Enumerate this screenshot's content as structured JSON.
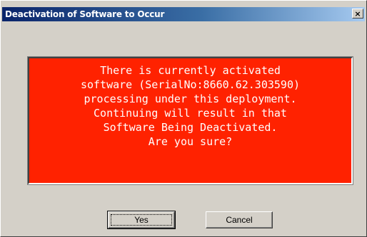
{
  "window": {
    "title": "Deactivation of Software to Occur",
    "close_label": "×"
  },
  "message": {
    "lines": [
      "There is currently activated",
      "software (SerialNo:8660.62.303590)",
      "processing under this deployment.",
      "Continuing will result in that",
      "Software Being Deactivated.",
      "Are you sure?"
    ]
  },
  "buttons": {
    "yes_label": "Yes",
    "cancel_label": "Cancel"
  },
  "colors": {
    "dialog_background": "#d4d0c8",
    "title_bar_start": "#0a246a",
    "title_bar_end": "#a6caf0",
    "message_background": "#ff2200",
    "message_text": "#ffffff"
  }
}
